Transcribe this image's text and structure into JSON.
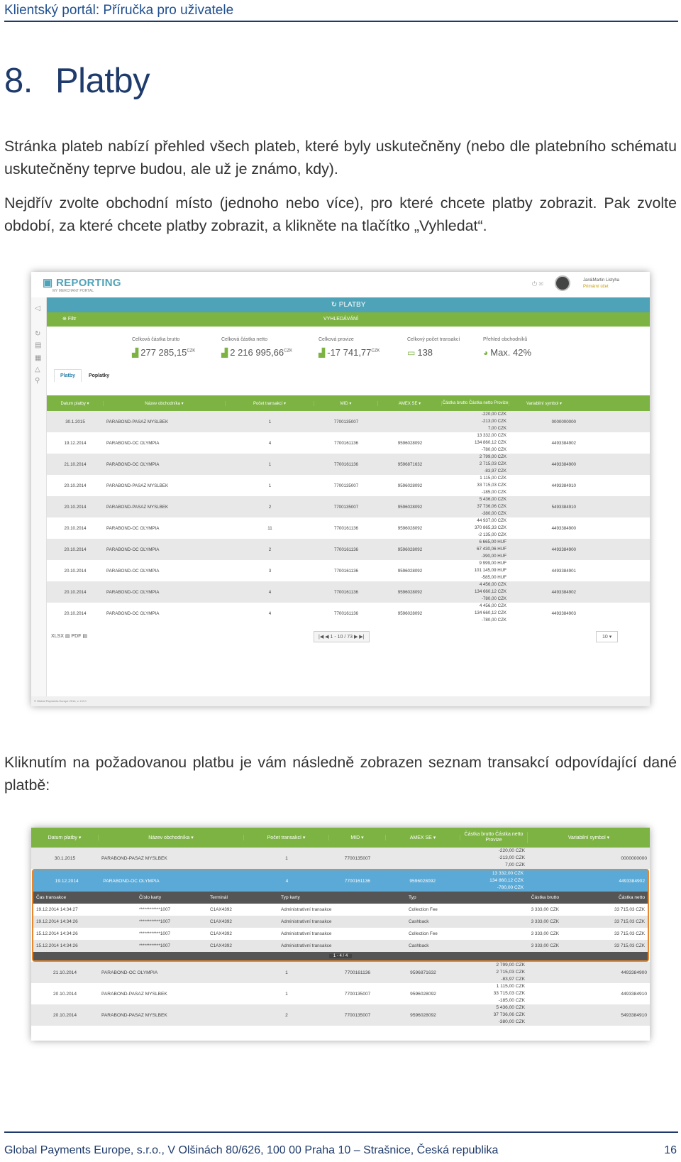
{
  "document": {
    "header": "Klientský portál: Příručka pro uživatele",
    "chapter_number": "8.",
    "chapter_title": "Platby",
    "para1": "Stránka plateb nabízí přehled všech plateb, které byly uskutečněny (nebo dle platebního schématu uskutečněny teprve budou, ale už je známo, kdy).",
    "para2": "Nejdřív zvolte obchodní místo (jednoho nebo více), pro které chcete platby zobrazit. Pak zvolte období, za které chcete platby zobrazit, a klikněte na tlačítko „Vyhledat“.",
    "para3": "Kliknutím na požadovanou platbu je vám následně zobrazen seznam transakcí odpovídající dané platbě:",
    "footer": "Global Payments Europe, s.r.o., V Olšinách 80/626, 100 00 Praha 10 – Strašnice, Česká republika",
    "page_number": "16"
  },
  "portal": {
    "logo": "REPORTING",
    "logo_sub": "MY MERCHANT PORTAL",
    "user_name": "Jan&Martin Listyha",
    "user_sub": "Primární účet",
    "page_title": "PLATBY",
    "filter_label": "Filtr",
    "search_label": "VYHLEDÁVÁNÍ",
    "summary": [
      {
        "label": "Celková částka brutto",
        "value": "277 285,15",
        "unit": "CZK",
        "icon": "chart-icon"
      },
      {
        "label": "Celková částka netto",
        "value": "2 216 995,66",
        "unit": "CZK",
        "icon": "chart-icon"
      },
      {
        "label": "Celková provize",
        "value": "-17 741,77",
        "unit": "CZK",
        "icon": "chart-icon"
      },
      {
        "label": "Celkový počet transakcí",
        "value": "138",
        "unit": "",
        "icon": "card-icon"
      },
      {
        "label": "Přehled obchodníků",
        "value": "Max. 42%",
        "unit": "",
        "icon": "pie-icon"
      }
    ],
    "tabs": [
      "Platby",
      "Poplatky"
    ],
    "columns": [
      "Datum platby",
      "Název obchodníka",
      "Počet transakcí",
      "MID",
      "AMEX SE",
      "Částka brutto Částka netto Provize",
      "Variabilní symbol"
    ],
    "rows": [
      {
        "date": "30.1.2015",
        "name": "PARABOND-PASAZ MYSLBEK",
        "count": "1",
        "mid": "7700135007",
        "amex": "",
        "brutto": "-220,00 CZK",
        "netto": "-213,00 CZK",
        "fee": "7,00 CZK",
        "vs": "0000000000"
      },
      {
        "date": "19.12.2014",
        "name": "PARABOND-OC OLYMPIA",
        "count": "4",
        "mid": "7700161136",
        "amex": "9596028092",
        "brutto": "13 332,00 CZK",
        "netto": "134 860,12 CZK",
        "fee": "-780,00 CZK",
        "vs": "4493384902"
      },
      {
        "date": "21.10.2014",
        "name": "PARABOND-OC OLYMPIA",
        "count": "1",
        "mid": "7700161136",
        "amex": "9596871632",
        "brutto": "2 799,00 CZK",
        "netto": "2 715,03 CZK",
        "fee": "-83,97 CZK",
        "vs": "4493384900"
      },
      {
        "date": "20.10.2014",
        "name": "PARABOND-PASAZ MYSLBEK",
        "count": "1",
        "mid": "7700135007",
        "amex": "9596028092",
        "brutto": "1 115,00 CZK",
        "netto": "33 715,03 CZK",
        "fee": "-185,00 CZK",
        "vs": "4493384910"
      },
      {
        "date": "20.10.2014",
        "name": "PARABOND-PASAZ MYSLBEK",
        "count": "2",
        "mid": "7700135007",
        "amex": "9596028092",
        "brutto": "5 436,00 CZK",
        "netto": "37 736,06 CZK",
        "fee": "-380,00 CZK",
        "vs": "5493384910"
      },
      {
        "date": "20.10.2014",
        "name": "PARABOND-OC OLYMPIA",
        "count": "11",
        "mid": "7700161136",
        "amex": "9596028092",
        "brutto": "44 937,00 CZK",
        "netto": "370 865,33 CZK",
        "fee": "-2 135,00 CZK",
        "vs": "4493384900"
      },
      {
        "date": "20.10.2014",
        "name": "PARABOND-OC OLYMPIA",
        "count": "2",
        "mid": "7700161136",
        "amex": "9596028092",
        "brutto": "6 665,00 HUF",
        "netto": "67 430,06 HUF",
        "fee": "-390,00 HUF",
        "vs": "4493384900"
      },
      {
        "date": "20.10.2014",
        "name": "PARABOND-OC OLYMPIA",
        "count": "3",
        "mid": "7700161136",
        "amex": "9596028092",
        "brutto": "9 999,00 HUF",
        "netto": "101 145,09 HUF",
        "fee": "-585,00 HUF",
        "vs": "4493384901"
      },
      {
        "date": "20.10.2014",
        "name": "PARABOND-OC OLYMPIA",
        "count": "4",
        "mid": "7700161136",
        "amex": "9596028092",
        "brutto": "4 456,00 CZK",
        "netto": "134 660,12 CZK",
        "fee": "-780,00 CZK",
        "vs": "4493384902"
      },
      {
        "date": "20.10.2014",
        "name": "PARABOND-OC OLYMPIA",
        "count": "4",
        "mid": "7700161136",
        "amex": "9596028092",
        "brutto": "4 456,00 CZK",
        "netto": "134 660,12 CZK",
        "fee": "-780,00 CZK",
        "vs": "4493384903"
      }
    ],
    "export_xlsx": "XLSX",
    "export_pdf": "PDF",
    "pager": "1 - 10 / 73",
    "page_size": "10",
    "copyright": "© Global Payments Europe 2014, v. 2.2.0"
  },
  "detail": {
    "rows": [
      {
        "date": "30.1.2015",
        "name": "PARABOND-PASAZ MYSLBEK",
        "count": "1",
        "mid": "7700135007",
        "amex": "",
        "brutto": "-220,00 CZK",
        "netto": "-213,00 CZK",
        "fee": "7,00 CZK",
        "vs": "0000000000"
      },
      {
        "date": "19.12.2014",
        "name": "PARABOND-OC OLYMPIA",
        "count": "4",
        "mid": "7700161136",
        "amex": "9596028092",
        "brutto": "13 332,00 CZK",
        "netto": "134 860,12 CZK",
        "fee": "-780,00 CZK",
        "vs": "4493384902"
      },
      {
        "date": "21.10.2014",
        "name": "PARABOND-OC OLYMPIA",
        "count": "1",
        "mid": "7700161136",
        "amex": "9596871632",
        "brutto": "2 799,00 CZK",
        "netto": "2 715,03 CZK",
        "fee": "-83,97 CZK",
        "vs": "4493384900"
      },
      {
        "date": "20.10.2014",
        "name": "PARABOND-PASAZ MYSLBEK",
        "count": "1",
        "mid": "7700135007",
        "amex": "9596028092",
        "brutto": "1 115,00 CZK",
        "netto": "33 715,03 CZK",
        "fee": "-185,00 CZK",
        "vs": "4493384910"
      },
      {
        "date": "20.10.2014",
        "name": "PARABOND-PASAZ MYSLBEK",
        "count": "2",
        "mid": "7700135007",
        "amex": "9596028092",
        "brutto": "5 436,00 CZK",
        "netto": "37 736,06 CZK",
        "fee": "-380,00 CZK",
        "vs": "5493384910"
      }
    ],
    "tx_columns": [
      "Čas transakce",
      "Číslo karty",
      "Terminál",
      "Typ karty",
      "Typ",
      "Částka brutto",
      "Částka netto"
    ],
    "transactions": [
      {
        "time": "19.12.2014 14:34:27",
        "card": "************1007",
        "terminal": "C1AX4392",
        "card_type": "Administrativní transakce",
        "type": "Collection Fee",
        "brutto": "3 333,00 CZK",
        "netto": "33 715,03 CZK"
      },
      {
        "time": "19.12.2014 14:34:26",
        "card": "************1007",
        "terminal": "C1AX4392",
        "card_type": "Administrativní transakce",
        "type": "Cashback",
        "brutto": "3 333,00 CZK",
        "netto": "33 715,03 CZK"
      },
      {
        "time": "15.12.2014 14:34:26",
        "card": "************1007",
        "terminal": "C1AX4392",
        "card_type": "Administrativní transakce",
        "type": "Collection Fee",
        "brutto": "3 333,00 CZK",
        "netto": "33 715,03 CZK"
      },
      {
        "time": "15.12.2014 14:34:26",
        "card": "************1007",
        "terminal": "C1AX4392",
        "card_type": "Administrativní transakce",
        "type": "Cashback",
        "brutto": "3 333,00 CZK",
        "netto": "33 715,03 CZK"
      }
    ],
    "tx_pager": "1 - 4 / 4"
  }
}
